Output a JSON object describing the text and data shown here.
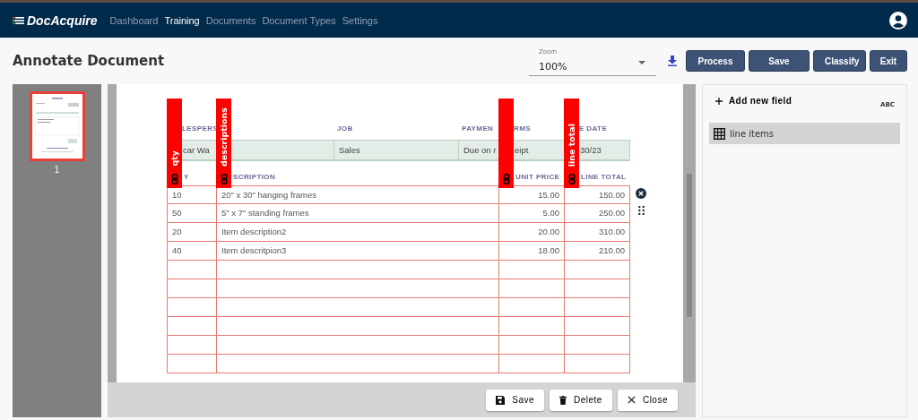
{
  "app": {
    "logo": "DocAcquire",
    "nav": [
      {
        "label": "Dashboard",
        "selected": false
      },
      {
        "label": "Training",
        "selected": true
      },
      {
        "label": "Documents",
        "selected": false
      },
      {
        "label": "Document Types",
        "selected": false
      },
      {
        "label": "Settings",
        "selected": false
      }
    ]
  },
  "page": {
    "title": "Annotate Document"
  },
  "zoom": {
    "label": "Zoom",
    "value": "100%"
  },
  "actions": [
    "Process",
    "Save",
    "Classify",
    "Exit"
  ],
  "pages": [
    {
      "number": "1",
      "selected": true
    }
  ],
  "document": {
    "info_headers": [
      "LESPERS",
      "JOB",
      "PAYMEN",
      "RMS",
      "E DATE"
    ],
    "info_values": [
      "car Wa",
      "Sales",
      "Due on r",
      "eipt",
      "30/23"
    ],
    "columns": [
      "Y",
      "SCRIPTION",
      "UNIT PRICE",
      "LINE TOTAL"
    ],
    "rows": [
      [
        "10",
        "20\" x 30\" hanging frames",
        "15.00",
        "150.00"
      ],
      [
        "50",
        "5\" x 7\" standing frames",
        "5.00",
        "250.00"
      ],
      [
        "20",
        "Item description2",
        "20.00",
        "310.00"
      ],
      [
        "40",
        "Item descritpion3",
        "18.00",
        "210.00"
      ]
    ],
    "column_tags": [
      {
        "kind": "labelled",
        "label": "qty"
      },
      {
        "kind": "labelled",
        "label": "descriptions"
      },
      {
        "kind": "unlabelled"
      },
      {
        "kind": "labelled",
        "label": "line total"
      }
    ]
  },
  "bottom_bar": [
    "Save",
    "Delete",
    "Close"
  ],
  "fields_panel": {
    "add_label": "Add new field",
    "type_hint": "ABC",
    "fields": [
      {
        "label": "line items",
        "selected": true
      }
    ]
  }
}
